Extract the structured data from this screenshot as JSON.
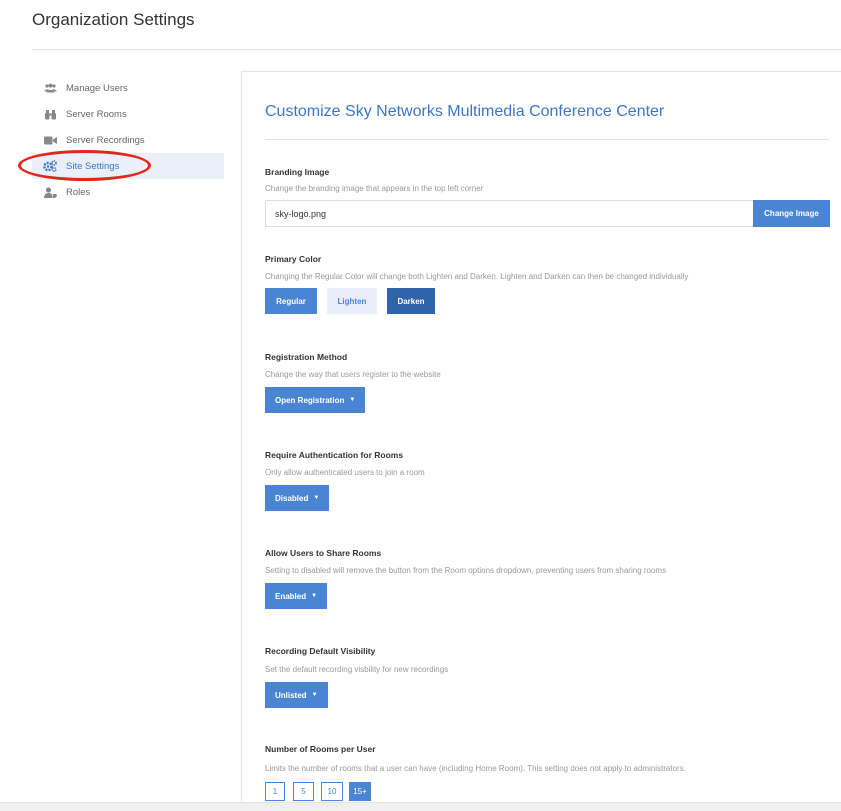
{
  "page": {
    "title": "Organization Settings"
  },
  "sidebar": {
    "items": [
      {
        "label": "Manage Users",
        "icon": "users-icon"
      },
      {
        "label": "Server Rooms",
        "icon": "binoculars-icon"
      },
      {
        "label": "Server Recordings",
        "icon": "video-camera-icon"
      },
      {
        "label": "Site Settings",
        "icon": "cogs-icon",
        "active": true
      },
      {
        "label": "Roles",
        "icon": "user-tag-icon"
      }
    ]
  },
  "main": {
    "title": "Customize Sky Networks Multimedia Conference Center",
    "branding": {
      "label": "Branding Image",
      "description": "Change the branding image that appears in the top left corner",
      "value": "sky-logo.png",
      "button": "Change Image"
    },
    "primary_color": {
      "label": "Primary Color",
      "description": "Changing the Regular Color will change both Lighten and Darken. Lighten and Darken can then be changed individually",
      "regular": "Regular",
      "lighten": "Lighten",
      "darken": "Darken"
    },
    "registration": {
      "label": "Registration Method",
      "description": "Change the way that users register to the website",
      "value": "Open Registration"
    },
    "require_auth": {
      "label": "Require Authentication for Rooms",
      "description": "Only allow authenticated users to join a room",
      "value": "Disabled"
    },
    "share_rooms": {
      "label": "Allow Users to Share Rooms",
      "description": "Setting to disabled will remove the button from the Room options dropdown, preventing users from sharing rooms",
      "value": "Enabled"
    },
    "recording_visibility": {
      "label": "Recording Default Visibility",
      "description": "Set the default recording visbility for new recordings",
      "value": "Unlisted"
    },
    "rooms_per_user": {
      "label": "Number of Rooms per User",
      "description": "Limits the number of rooms that a user can have (including Home Room). This setting does not apply to administrators.",
      "options": [
        "1",
        "5",
        "10",
        "15+"
      ],
      "selected": "15+"
    }
  },
  "colors": {
    "accent": "#4a85d3",
    "darken": "#2f63aa",
    "lighten": "#e7eef8",
    "highlight": "#e3261b"
  }
}
